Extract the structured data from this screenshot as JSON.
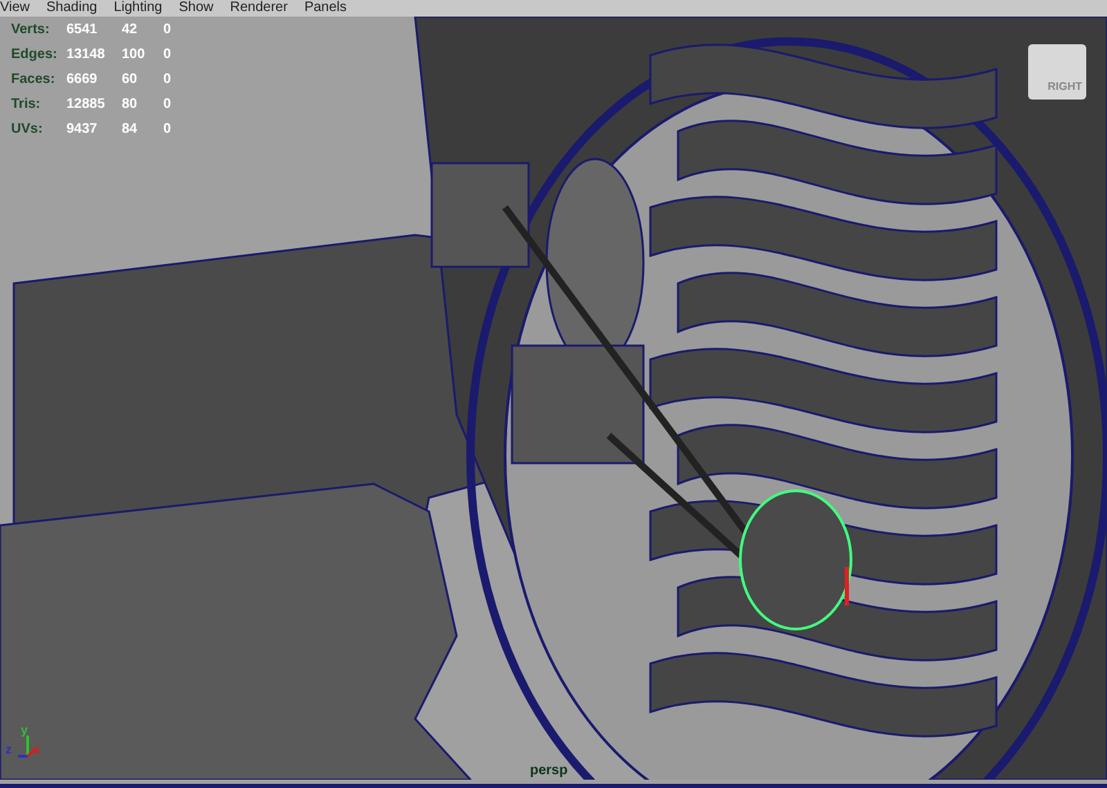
{
  "menu": [
    "View",
    "Shading",
    "Lighting",
    "Show",
    "Renderer",
    "Panels"
  ],
  "stats": [
    {
      "label": "Verts:",
      "values": [
        "6541",
        "42",
        "0"
      ]
    },
    {
      "label": "Edges:",
      "values": [
        "13148",
        "100",
        "0"
      ]
    },
    {
      "label": "Faces:",
      "values": [
        "6669",
        "60",
        "0"
      ]
    },
    {
      "label": "Tris:",
      "values": [
        "12885",
        "80",
        "0"
      ]
    },
    {
      "label": "UVs:",
      "values": [
        "9437",
        "84",
        "0"
      ]
    }
  ],
  "view_cube": {
    "face": "RIGHT"
  },
  "axes": {
    "y": "y",
    "z": "z",
    "x": "x"
  },
  "camera": "persp"
}
